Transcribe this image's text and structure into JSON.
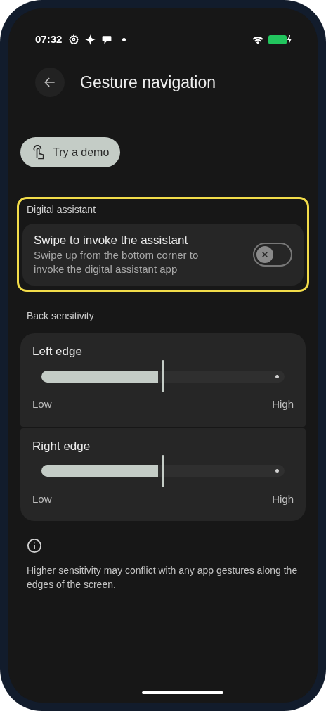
{
  "status_bar": {
    "time": "07:32"
  },
  "header": {
    "title": "Gesture navigation"
  },
  "demo_button": {
    "label": "Try a demo"
  },
  "assistant_section": {
    "heading": "Digital assistant",
    "highlighted": true,
    "setting": {
      "title": "Swipe to invoke the assistant",
      "description": "Swipe up from the bottom corner to invoke the digital assistant app",
      "on": false
    }
  },
  "sensitivity_section": {
    "heading": "Back sensitivity",
    "sliders": [
      {
        "label": "Left edge",
        "level": 0.5,
        "min_label": "Low",
        "max_label": "High"
      },
      {
        "label": "Right edge",
        "level": 0.5,
        "min_label": "Low",
        "max_label": "High"
      }
    ]
  },
  "info": {
    "text": "Higher sensitivity may conflict with any app gestures along the edges of the screen."
  }
}
